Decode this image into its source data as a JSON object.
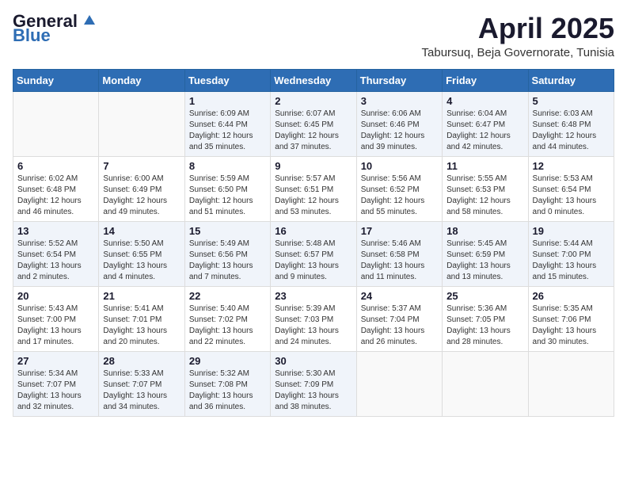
{
  "logo": {
    "general": "General",
    "blue": "Blue"
  },
  "title": "April 2025",
  "subtitle": "Tabursuq, Beja Governorate, Tunisia",
  "days_of_week": [
    "Sunday",
    "Monday",
    "Tuesday",
    "Wednesday",
    "Thursday",
    "Friday",
    "Saturday"
  ],
  "weeks": [
    [
      {
        "day": "",
        "info": ""
      },
      {
        "day": "",
        "info": ""
      },
      {
        "day": "1",
        "sunrise": "Sunrise: 6:09 AM",
        "sunset": "Sunset: 6:44 PM",
        "daylight": "Daylight: 12 hours and 35 minutes."
      },
      {
        "day": "2",
        "sunrise": "Sunrise: 6:07 AM",
        "sunset": "Sunset: 6:45 PM",
        "daylight": "Daylight: 12 hours and 37 minutes."
      },
      {
        "day": "3",
        "sunrise": "Sunrise: 6:06 AM",
        "sunset": "Sunset: 6:46 PM",
        "daylight": "Daylight: 12 hours and 39 minutes."
      },
      {
        "day": "4",
        "sunrise": "Sunrise: 6:04 AM",
        "sunset": "Sunset: 6:47 PM",
        "daylight": "Daylight: 12 hours and 42 minutes."
      },
      {
        "day": "5",
        "sunrise": "Sunrise: 6:03 AM",
        "sunset": "Sunset: 6:48 PM",
        "daylight": "Daylight: 12 hours and 44 minutes."
      }
    ],
    [
      {
        "day": "6",
        "sunrise": "Sunrise: 6:02 AM",
        "sunset": "Sunset: 6:48 PM",
        "daylight": "Daylight: 12 hours and 46 minutes."
      },
      {
        "day": "7",
        "sunrise": "Sunrise: 6:00 AM",
        "sunset": "Sunset: 6:49 PM",
        "daylight": "Daylight: 12 hours and 49 minutes."
      },
      {
        "day": "8",
        "sunrise": "Sunrise: 5:59 AM",
        "sunset": "Sunset: 6:50 PM",
        "daylight": "Daylight: 12 hours and 51 minutes."
      },
      {
        "day": "9",
        "sunrise": "Sunrise: 5:57 AM",
        "sunset": "Sunset: 6:51 PM",
        "daylight": "Daylight: 12 hours and 53 minutes."
      },
      {
        "day": "10",
        "sunrise": "Sunrise: 5:56 AM",
        "sunset": "Sunset: 6:52 PM",
        "daylight": "Daylight: 12 hours and 55 minutes."
      },
      {
        "day": "11",
        "sunrise": "Sunrise: 5:55 AM",
        "sunset": "Sunset: 6:53 PM",
        "daylight": "Daylight: 12 hours and 58 minutes."
      },
      {
        "day": "12",
        "sunrise": "Sunrise: 5:53 AM",
        "sunset": "Sunset: 6:54 PM",
        "daylight": "Daylight: 13 hours and 0 minutes."
      }
    ],
    [
      {
        "day": "13",
        "sunrise": "Sunrise: 5:52 AM",
        "sunset": "Sunset: 6:54 PM",
        "daylight": "Daylight: 13 hours and 2 minutes."
      },
      {
        "day": "14",
        "sunrise": "Sunrise: 5:50 AM",
        "sunset": "Sunset: 6:55 PM",
        "daylight": "Daylight: 13 hours and 4 minutes."
      },
      {
        "day": "15",
        "sunrise": "Sunrise: 5:49 AM",
        "sunset": "Sunset: 6:56 PM",
        "daylight": "Daylight: 13 hours and 7 minutes."
      },
      {
        "day": "16",
        "sunrise": "Sunrise: 5:48 AM",
        "sunset": "Sunset: 6:57 PM",
        "daylight": "Daylight: 13 hours and 9 minutes."
      },
      {
        "day": "17",
        "sunrise": "Sunrise: 5:46 AM",
        "sunset": "Sunset: 6:58 PM",
        "daylight": "Daylight: 13 hours and 11 minutes."
      },
      {
        "day": "18",
        "sunrise": "Sunrise: 5:45 AM",
        "sunset": "Sunset: 6:59 PM",
        "daylight": "Daylight: 13 hours and 13 minutes."
      },
      {
        "day": "19",
        "sunrise": "Sunrise: 5:44 AM",
        "sunset": "Sunset: 7:00 PM",
        "daylight": "Daylight: 13 hours and 15 minutes."
      }
    ],
    [
      {
        "day": "20",
        "sunrise": "Sunrise: 5:43 AM",
        "sunset": "Sunset: 7:00 PM",
        "daylight": "Daylight: 13 hours and 17 minutes."
      },
      {
        "day": "21",
        "sunrise": "Sunrise: 5:41 AM",
        "sunset": "Sunset: 7:01 PM",
        "daylight": "Daylight: 13 hours and 20 minutes."
      },
      {
        "day": "22",
        "sunrise": "Sunrise: 5:40 AM",
        "sunset": "Sunset: 7:02 PM",
        "daylight": "Daylight: 13 hours and 22 minutes."
      },
      {
        "day": "23",
        "sunrise": "Sunrise: 5:39 AM",
        "sunset": "Sunset: 7:03 PM",
        "daylight": "Daylight: 13 hours and 24 minutes."
      },
      {
        "day": "24",
        "sunrise": "Sunrise: 5:37 AM",
        "sunset": "Sunset: 7:04 PM",
        "daylight": "Daylight: 13 hours and 26 minutes."
      },
      {
        "day": "25",
        "sunrise": "Sunrise: 5:36 AM",
        "sunset": "Sunset: 7:05 PM",
        "daylight": "Daylight: 13 hours and 28 minutes."
      },
      {
        "day": "26",
        "sunrise": "Sunrise: 5:35 AM",
        "sunset": "Sunset: 7:06 PM",
        "daylight": "Daylight: 13 hours and 30 minutes."
      }
    ],
    [
      {
        "day": "27",
        "sunrise": "Sunrise: 5:34 AM",
        "sunset": "Sunset: 7:07 PM",
        "daylight": "Daylight: 13 hours and 32 minutes."
      },
      {
        "day": "28",
        "sunrise": "Sunrise: 5:33 AM",
        "sunset": "Sunset: 7:07 PM",
        "daylight": "Daylight: 13 hours and 34 minutes."
      },
      {
        "day": "29",
        "sunrise": "Sunrise: 5:32 AM",
        "sunset": "Sunset: 7:08 PM",
        "daylight": "Daylight: 13 hours and 36 minutes."
      },
      {
        "day": "30",
        "sunrise": "Sunrise: 5:30 AM",
        "sunset": "Sunset: 7:09 PM",
        "daylight": "Daylight: 13 hours and 38 minutes."
      },
      {
        "day": "",
        "info": ""
      },
      {
        "day": "",
        "info": ""
      },
      {
        "day": "",
        "info": ""
      }
    ]
  ]
}
